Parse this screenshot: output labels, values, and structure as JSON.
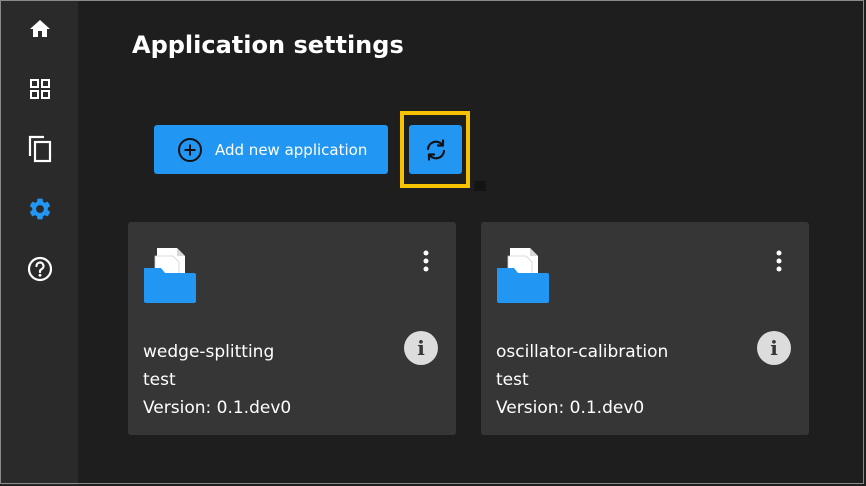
{
  "sidebar": {
    "items": [
      {
        "icon": "home-icon",
        "active": false
      },
      {
        "icon": "grid-icon",
        "active": false
      },
      {
        "icon": "copy-icon",
        "active": false
      },
      {
        "icon": "gear-icon",
        "active": true
      },
      {
        "icon": "help-icon",
        "active": false
      }
    ]
  },
  "page": {
    "title": "Application settings"
  },
  "toolbar": {
    "add_label": "Add new application",
    "refresh_icon": "refresh-icon"
  },
  "cards": [
    {
      "name": "wedge-splitting",
      "description": "test",
      "version": "Version: 0.1.dev0"
    },
    {
      "name": "oscillator-calibration",
      "description": "test",
      "version": "Version: 0.1.dev0"
    }
  ],
  "colors": {
    "accent": "#2196f3",
    "highlight": "#f7c300",
    "sidebar_bg": "#2a2a2a",
    "main_bg": "#1e1e1e",
    "card_bg": "#363636"
  }
}
